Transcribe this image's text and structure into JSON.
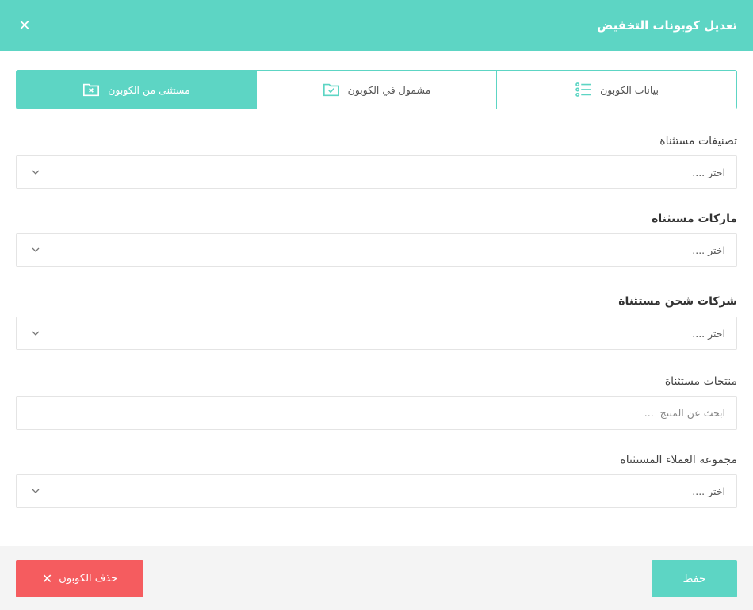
{
  "header": {
    "title": "تعديل كوبونات التخفيض",
    "close_icon": "close-icon"
  },
  "tabs": [
    {
      "label": "بيانات الكوبون",
      "icon": "list-icon",
      "active": false
    },
    {
      "label": "مشمول في الكوبون",
      "icon": "folder-check-icon",
      "active": false
    },
    {
      "label": "مستثنى من الكوبون",
      "icon": "folder-x-icon",
      "active": true
    }
  ],
  "fields": {
    "categories": {
      "label": "تصنيفات مستثناة",
      "value": "اختر ...."
    },
    "brands": {
      "label": "ماركات مستثناة",
      "value": "اختر ...."
    },
    "shipping": {
      "label": "شركات شحن مستثناة",
      "value": "اختر ...."
    },
    "products": {
      "label": "منتجات مستثناة",
      "placeholder": "ابحث عن المنتج  ..."
    },
    "customer_groups": {
      "label": "مجموعة العملاء المستثناة",
      "value": "اختر ...."
    }
  },
  "footer": {
    "save_label": "حفظ",
    "delete_label": "حذف الكوبون"
  },
  "colors": {
    "accent": "#5dd5c4",
    "danger": "#f55c5f",
    "footer_bg": "#f4f4f4"
  }
}
